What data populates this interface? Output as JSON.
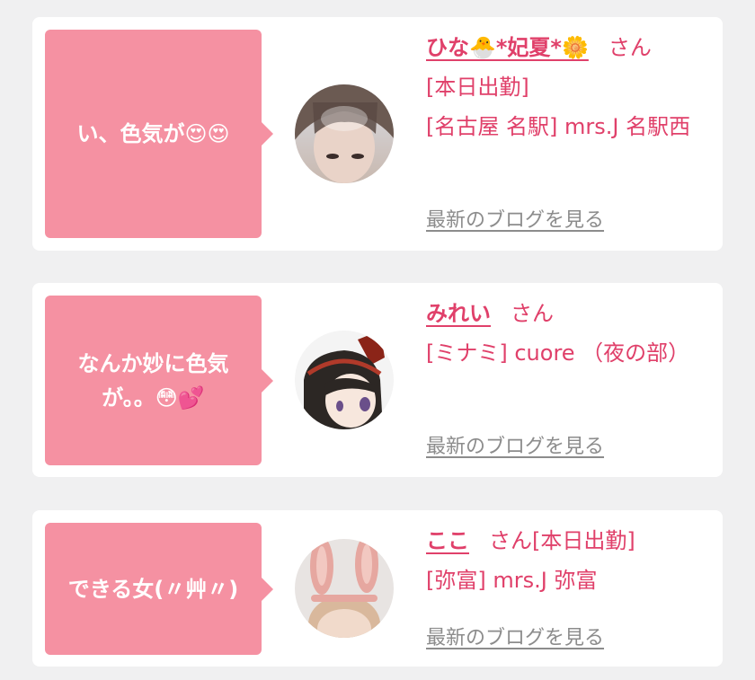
{
  "posts": [
    {
      "comment": "い、色気が😍😍",
      "name": "ひな🐣*妃夏*🌼",
      "honorific": "さん",
      "status": "[本日出勤]",
      "shop": "[名古屋 名駅] mrs.J 名駅西",
      "blog_link": "最新のブログを見る",
      "avatar_icon": "profile-photo-woman-icon"
    },
    {
      "comment": "なんか妙に色気が。。😳💕",
      "name": "みれい",
      "honorific": "さん",
      "status": "",
      "shop": "[ミナミ] cuore （夜の部）",
      "blog_link": "最新のブログを見る",
      "avatar_icon": "anime-girl-avatar-icon"
    },
    {
      "comment": "できる女(〃艸〃)",
      "name": "ここ",
      "honorific": "さん",
      "status": "[本日出勤]",
      "shop": "[弥富] mrs.J 弥富",
      "blog_link": "最新のブログを見る",
      "avatar_icon": "bunny-ears-photo-icon"
    }
  ],
  "colors": {
    "page_bg": "#f0f0f1",
    "bubble": "#f591a2",
    "accent_text": "#e0406a",
    "link_grey": "#8c8c8c"
  }
}
